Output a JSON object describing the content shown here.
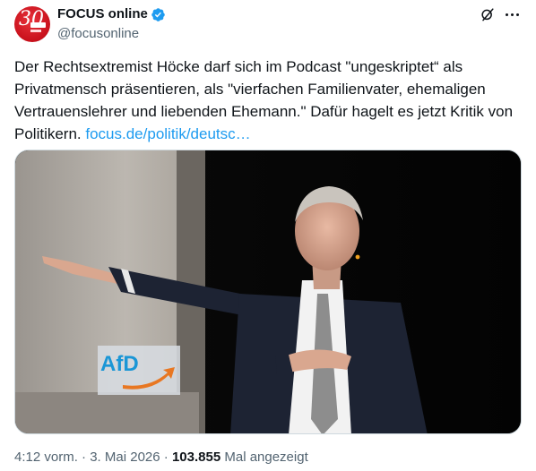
{
  "author": {
    "display_name": "FOCUS online",
    "handle": "@focusonline",
    "avatar_text": "30",
    "verified_color": "#1d9bf0"
  },
  "tweet": {
    "text": "Der Rechtsextremist Höcke darf sich im Podcast \"ungeskriptet“ als Privatmensch präsentieren, als \"vierfachen Familienvater, ehemaligen Vertrauenslehrer und liebenden Ehemann.\" Dafür hagelt es jetzt Kritik von Politikern. ",
    "link": "focus.de/politik/deutsc…"
  },
  "media": {
    "sign_text": "AfD",
    "sign_color": "#1a96d6",
    "arrow_color": "#e87722"
  },
  "meta": {
    "time": "4:12 vorm.",
    "separator1": " · ",
    "date": "3. Mai 2026",
    "separator2": " · ",
    "views": "103.855",
    "views_label": " Mal angezeigt"
  },
  "icons": {
    "grok": "grok-icon",
    "more": "more-icon",
    "verified": "verified-badge-icon"
  }
}
